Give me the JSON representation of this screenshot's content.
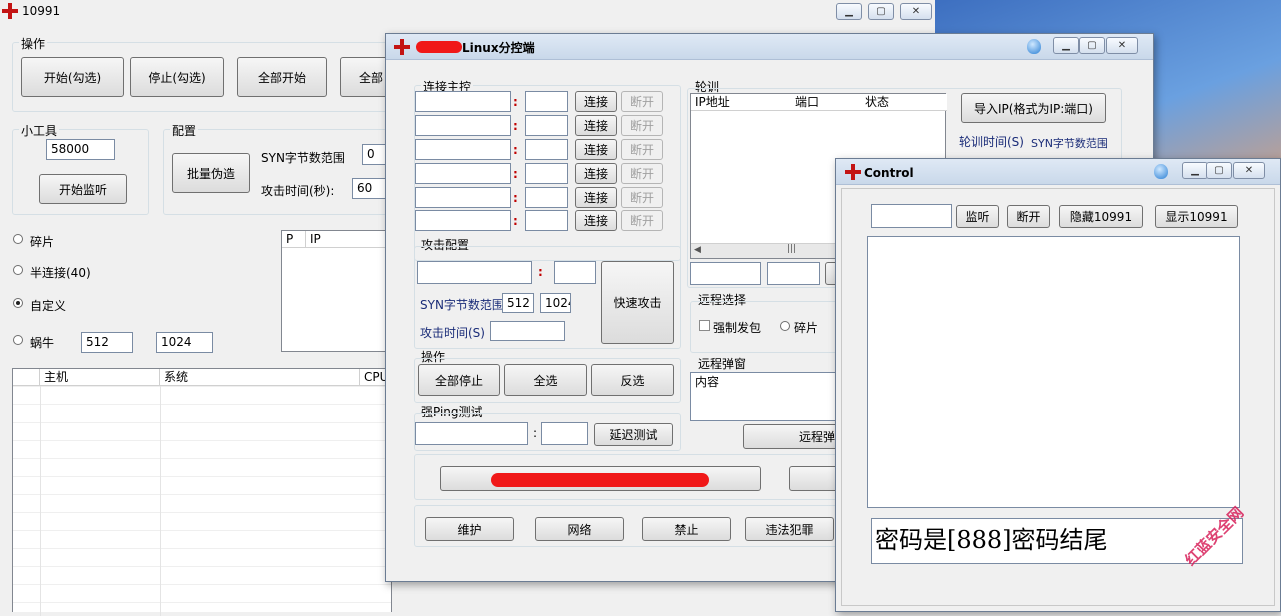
{
  "main": {
    "title": "10991",
    "ops": {
      "label": "操作",
      "start_checked": "开始(勾选)",
      "stop_checked": "停止(勾选)",
      "start_all": "全部开始",
      "partial": "全部"
    },
    "tools": {
      "label": "小工具",
      "port_value": "58000",
      "listen_button": "开始监听"
    },
    "config": {
      "label": "配置",
      "batch_button": "批量伪造",
      "syn_label": "SYN字节数范围",
      "syn_value": "0",
      "time_label": "攻击时间(秒):",
      "time_value": "60"
    },
    "modes": {
      "fragment": "碎片",
      "half": "半连接(40)",
      "custom": "自定义",
      "snail": "蜗牛",
      "snail_min": "512",
      "snail_max": "1024"
    },
    "small_list_cols": [
      "P",
      "IP"
    ],
    "host_cols": [
      "主机",
      "系统",
      "CPU"
    ]
  },
  "linux": {
    "title": "Linux分控端",
    "connect": {
      "label": "连接主控",
      "colon": ":",
      "connect_label": "连接",
      "disconnect_label": "断开"
    },
    "attack": {
      "label": "攻击配置",
      "colon": ":",
      "syn_label": "SYN字节数范围",
      "syn_min": "512",
      "syn_max": "1024",
      "time_label": "攻击时间(S)",
      "quick_button": "快速攻击"
    },
    "ops": {
      "label": "操作",
      "stop_all": "全部停止",
      "select_all": "全选",
      "invert": "反选"
    },
    "ping": {
      "label": "强Ping测试",
      "colon": ":",
      "test_button": "延迟测试"
    },
    "poll": {
      "label": "轮训",
      "cols": [
        "IP地址",
        "端口",
        "状态"
      ],
      "import_button": "导入IP(格式为IP:端口)",
      "interval_label": "轮训时间(S)",
      "syn_label": "SYN字节数范围",
      "scroll_mid": "|||"
    },
    "remote_select": {
      "label": "远程选择",
      "force_send": "强制发包",
      "fragment": "碎片"
    },
    "remote_popup": {
      "label": "远程弹窗",
      "content": "内容",
      "button_partial": "远程弹"
    },
    "bottom": {
      "maintain": "维护",
      "network": "网络",
      "ban": "禁止",
      "illegal": "违法犯罪"
    }
  },
  "control": {
    "title": "Control",
    "listen": "监听",
    "disconnect": "断开",
    "hide": "隐藏10991",
    "show": "显示10991",
    "message": "密码是[888]密码结尾"
  },
  "watermark": "红蓝安全网",
  "colors": {
    "accent_red": "#c31414",
    "label_navy": "#1a2c78",
    "window_bg": "#f0f0f0"
  }
}
